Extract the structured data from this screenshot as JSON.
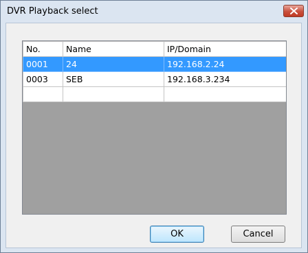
{
  "window": {
    "title": "DVR Playback select"
  },
  "table": {
    "columns": [
      "No.",
      "Name",
      "IP/Domain"
    ],
    "rows": [
      {
        "no": "0001",
        "name": "24",
        "ip": "192.168.2.24",
        "selected": true
      },
      {
        "no": "0003",
        "name": "SEB",
        "ip": "192.168.3.234",
        "selected": false
      }
    ]
  },
  "buttons": {
    "ok": "OK",
    "cancel": "Cancel"
  },
  "colors": {
    "selection": "#3399ff",
    "empty_area": "#a0a0a0",
    "close_button": "#c74b36"
  },
  "icons": {
    "close": "close-icon"
  }
}
